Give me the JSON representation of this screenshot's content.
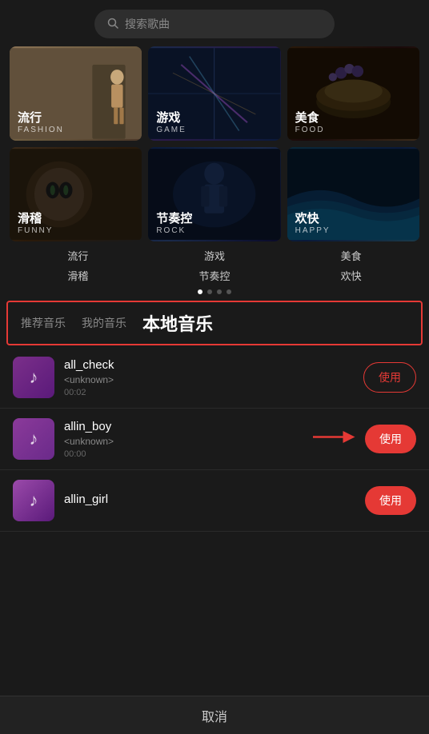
{
  "search": {
    "placeholder": "搜索歌曲"
  },
  "genres": [
    {
      "id": "fashion",
      "cn": "流行",
      "en": "FASHION",
      "label": "流行",
      "bgClass": "genre-bg-fashion"
    },
    {
      "id": "game",
      "cn": "游戏",
      "en": "GAME",
      "label": "游戏",
      "bgClass": "genre-bg-game"
    },
    {
      "id": "food",
      "cn": "美食",
      "en": "FOOD",
      "label": "美食",
      "bgClass": "genre-bg-food"
    },
    {
      "id": "funny",
      "cn": "滑稽",
      "en": "FUNNY",
      "label": "滑稽",
      "bgClass": "genre-bg-funny"
    },
    {
      "id": "rock",
      "cn": "节奏控",
      "en": "ROCK",
      "label": "节奏控",
      "bgClass": "genre-bg-rock"
    },
    {
      "id": "happy",
      "cn": "欢快",
      "en": "HAPPY",
      "label": "欢快",
      "bgClass": "genre-bg-happy"
    }
  ],
  "dots": [
    true,
    false,
    false,
    false
  ],
  "tabs": [
    {
      "id": "recommend",
      "label": "推荐音乐",
      "active": false
    },
    {
      "id": "my",
      "label": "我的音乐",
      "active": false
    },
    {
      "id": "local",
      "label": "本地音乐",
      "active": true
    }
  ],
  "songs": [
    {
      "id": "all_check",
      "title": "all_check",
      "artist": "<unknown>",
      "duration": "00:02",
      "btnLabel": "使用",
      "btnStyle": "outline"
    },
    {
      "id": "allin_boy",
      "title": "allin_boy",
      "artist": "<unknown>",
      "duration": "00:00",
      "btnLabel": "使用",
      "btnStyle": "filled",
      "hasArrow": true
    },
    {
      "id": "allin_girl",
      "title": "allin_girl",
      "artist": "",
      "duration": "",
      "btnLabel": "使用",
      "btnStyle": "filled"
    }
  ],
  "cancel": {
    "label": "取消"
  }
}
